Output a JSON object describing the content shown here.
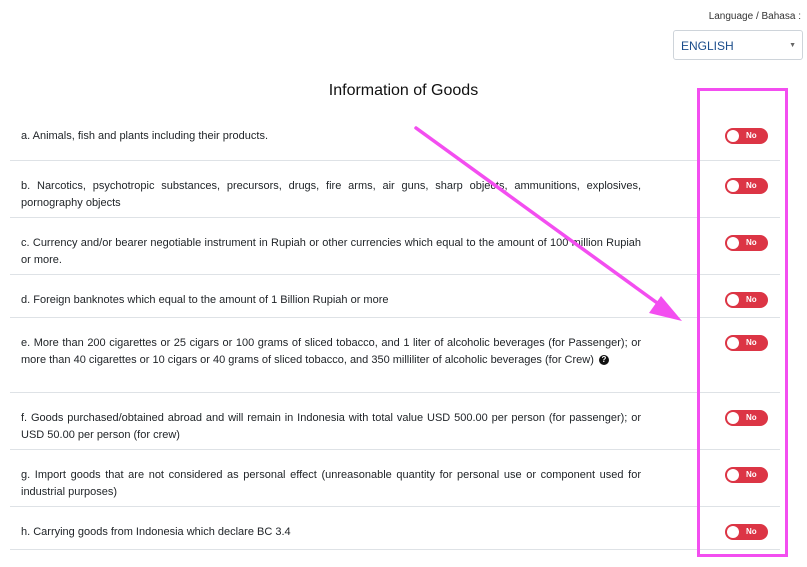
{
  "language": {
    "label": "Language / Bahasa :",
    "selected": "ENGLISH"
  },
  "title": "Information of Goods",
  "toggle_label": "No",
  "colors": {
    "toggle_off": "#dc3545",
    "annotation": "#f34ef0",
    "select_text": "#1a4c8b"
  },
  "items": [
    {
      "text": "a. Animals, fish and plants including their products.",
      "value": "No"
    },
    {
      "text": "b. Narcotics, psychotropic substances, precursors, drugs, fire arms, air guns, sharp objects, ammunitions, explosives, pornography objects",
      "value": "No"
    },
    {
      "text": "c. Currency and/or bearer negotiable instrument in Rupiah or other currencies which equal to the amount of 100 million Rupiah or more.",
      "value": "No"
    },
    {
      "text": "d. Foreign banknotes which equal to the amount of 1 Billion Rupiah or more",
      "value": "No"
    },
    {
      "text": "e. More than 200 cigarettes or 25 cigars or 100 grams of sliced tobacco, and 1 liter of alcoholic beverages (for Passenger); or more than 40 cigarettes or 10 cigars or 40 grams of sliced tobacco, and 350 milliliter of alcoholic beverages (for Crew)",
      "value": "No",
      "help_icon": "question-circle-icon"
    },
    {
      "text": "f. Goods purchased/obtained abroad and will remain in Indonesia with total value USD 500.00 per person (for passenger); or USD 50.00 per person (for crew)",
      "value": "No"
    },
    {
      "text": "g. Import goods that are not considered as personal effect (unreasonable quantity for personal use or component used for industrial purposes)",
      "value": "No"
    },
    {
      "text": "h. Carrying goods from Indonesia which declare BC 3.4",
      "value": "No"
    }
  ]
}
